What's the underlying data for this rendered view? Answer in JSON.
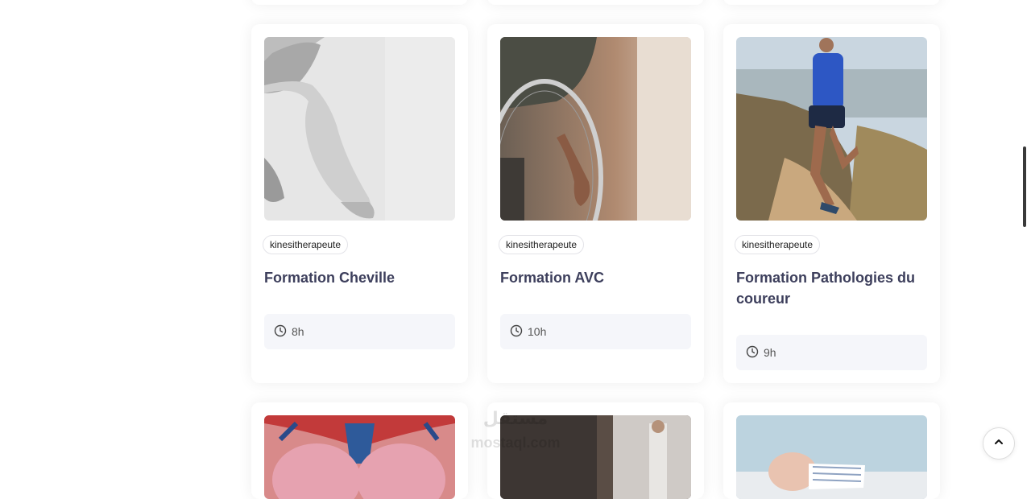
{
  "cards": [
    {
      "tag": "kinesitherapeute",
      "title": "Formation Cheville",
      "duration": "8h",
      "image": "foot-hands-photo"
    },
    {
      "tag": "kinesitherapeute",
      "title": "Formation AVC",
      "duration": "10h",
      "image": "wheelchair-photo"
    },
    {
      "tag": "kinesitherapeute",
      "title": "Formation Pathologies du coureur",
      "duration": "9h",
      "image": "trail-runner-photo"
    }
  ],
  "watermark": {
    "line1": "مستقل",
    "line2": "mostaql.com"
  },
  "colors": {
    "title": "#3d3f5c",
    "duration_bg": "#f5f6fa",
    "tag_border": "#e3e3e8"
  },
  "icons": {
    "duration": "clock-icon",
    "back_to_top": "chevron-up-icon"
  }
}
